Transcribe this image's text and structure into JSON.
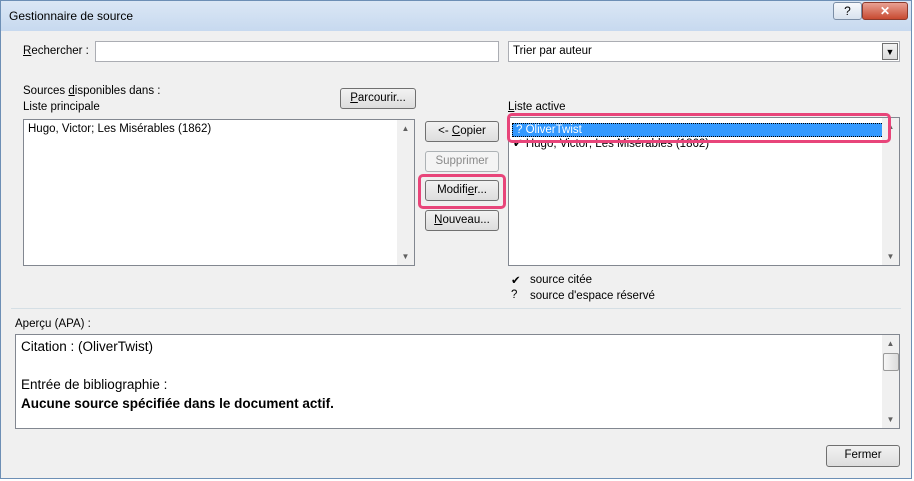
{
  "window": {
    "title": "Gestionnaire de source",
    "help_label": "?",
    "close_label": "✕"
  },
  "search": {
    "label_prefix": "",
    "label_underlined": "R",
    "label_rest": "echercher :",
    "value": ""
  },
  "sort": {
    "selected": "Trier par auteur",
    "arrow": "▼"
  },
  "sources": {
    "label_line1_a": "Sources ",
    "label_line1_u": "d",
    "label_line1_b": "isponibles dans :",
    "label_line2": "Liste principale",
    "browse_u": "P",
    "browse_rest": "arcourir...",
    "items": [
      "Hugo, Victor; Les Misérables (1862)"
    ]
  },
  "buttons": {
    "copy_a": "<- ",
    "copy_u": "C",
    "copy_b": "opier",
    "delete": "Supprimer",
    "modify_a": "Modifi",
    "modify_u": "e",
    "modify_b": "r...",
    "new_u": "N",
    "new_b": "ouveau...",
    "close": "Fermer"
  },
  "active": {
    "label_u": "L",
    "label_rest": "iste active",
    "items": [
      {
        "mark": "?",
        "text": "OliverTwist",
        "selected": true
      },
      {
        "mark": "✔",
        "text": "Hugo, Victor; Les Misérables (1862)",
        "selected": false
      }
    ]
  },
  "legend": {
    "cited_mark": "✔",
    "cited_text": "source citée",
    "placeholder_mark": "?",
    "placeholder_text": "source d'espace réservé"
  },
  "preview": {
    "label": "Aperçu (APA) :",
    "citation": "Citation :  (OliverTwist)",
    "biblio_label": "Entrée de bibliographie :",
    "biblio_text": "Aucune source spécifiée dans le document actif."
  },
  "scroll_arrows": {
    "up": "▲",
    "down": "▼"
  },
  "colors": {
    "selection": "#3399ff",
    "highlight": "#e8457a"
  }
}
